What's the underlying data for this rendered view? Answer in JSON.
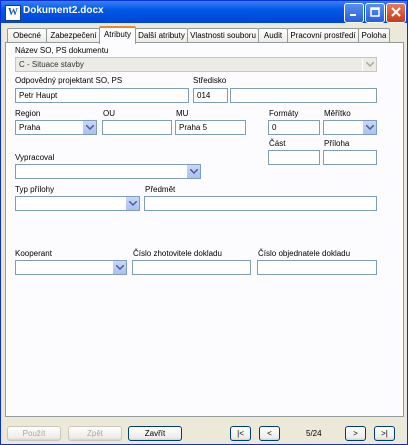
{
  "window": {
    "title": "Dokument2.docx",
    "app_icon": "W"
  },
  "tabs": [
    "Obecné",
    "Zabezpečení",
    "Atributy",
    "Další atributy",
    "Vlastnosti souboru",
    "Audit",
    "Pracovní prostředí",
    "Poloha"
  ],
  "form": {
    "nazev_label": "Název SO, PS dokumentu",
    "nazev_value": "C - Situace stavby",
    "projektant_label": "Odpovědný projektant SO, PS",
    "projektant_value": "Petr Haupt",
    "stredisko_label": "Středisko",
    "stredisko_code": "014",
    "stredisko_name": "",
    "region_label": "Region",
    "region_value": "Praha",
    "ou_label": "OU",
    "ou_value": "",
    "mu_label": "MU",
    "mu_value": "Praha 5",
    "formaty_label": "Formáty",
    "formaty_value": "0",
    "meritko_label": "Měřítko",
    "meritko_value": "",
    "cast_label": "Část",
    "cast_value": "",
    "priloha_label": "Příloha",
    "priloha_value": "",
    "vypracoval_label": "Vypracoval",
    "vypracoval_value": "",
    "typ_prilohy_label": "Typ přílohy",
    "typ_prilohy_value": "",
    "predmet_label": "Předmět",
    "predmet_value": "",
    "kooperant_label": "Kooperant",
    "kooperant_value": "",
    "cislo_zhotovitele_label": "Číslo zhotovitele dokladu",
    "cislo_zhotovitele_value": "",
    "cislo_objednatele_label": "Číslo objednatele dokladu",
    "cislo_objednatele_value": ""
  },
  "footer": {
    "pouzit": "Použít",
    "zpet": "Zpět",
    "zavrit": "Zavřít",
    "first": "|<",
    "prev": "<",
    "page_indicator": "5/24",
    "next": ">",
    "last": ">|"
  }
}
